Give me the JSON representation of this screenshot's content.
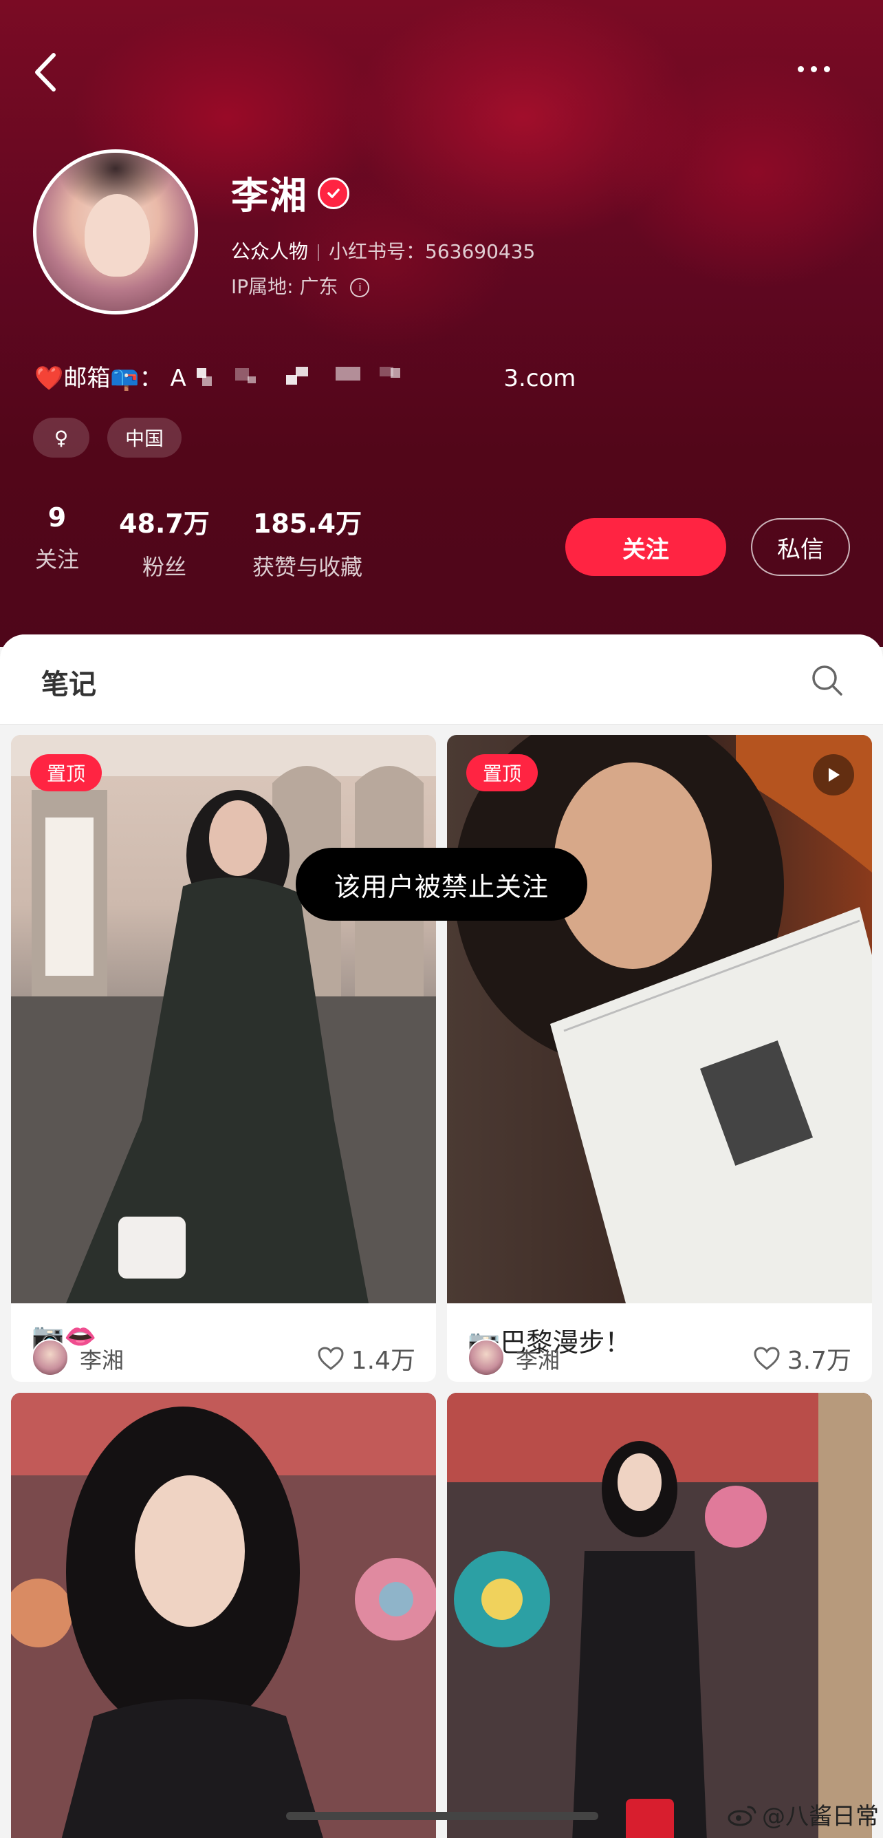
{
  "header": {
    "name": "李湘",
    "category": "公众人物",
    "id_label": "小红书号：",
    "id_value": "563690435",
    "ip_label": "IP属地: 广东",
    "bio": "❤️邮箱📪：",
    "bio_partial_start": "A",
    "bio_partial_end": "3.com",
    "tags": {
      "gender": "♀",
      "region": "中国"
    },
    "stats": {
      "following_num": "9",
      "following_label": "关注",
      "fans_num": "48.7万",
      "fans_label": "粉丝",
      "likes_num": "185.4万",
      "likes_label": "获赞与收藏"
    },
    "follow_btn": "关注",
    "message_btn": "私信"
  },
  "tabs": {
    "notes": "笔记"
  },
  "toast": "该用户被禁止关注",
  "notes": [
    {
      "pinned": "置顶",
      "title": "📷👄",
      "author": "李湘",
      "likes": "1.4万"
    },
    {
      "pinned": "置顶",
      "title": "📷巴黎漫步！",
      "author": "李湘",
      "likes": "3.7万"
    },
    {},
    {}
  ],
  "watermark": "@八酱日常",
  "colors": {
    "accent": "#ff2442",
    "header_bg": "#5e0720"
  }
}
